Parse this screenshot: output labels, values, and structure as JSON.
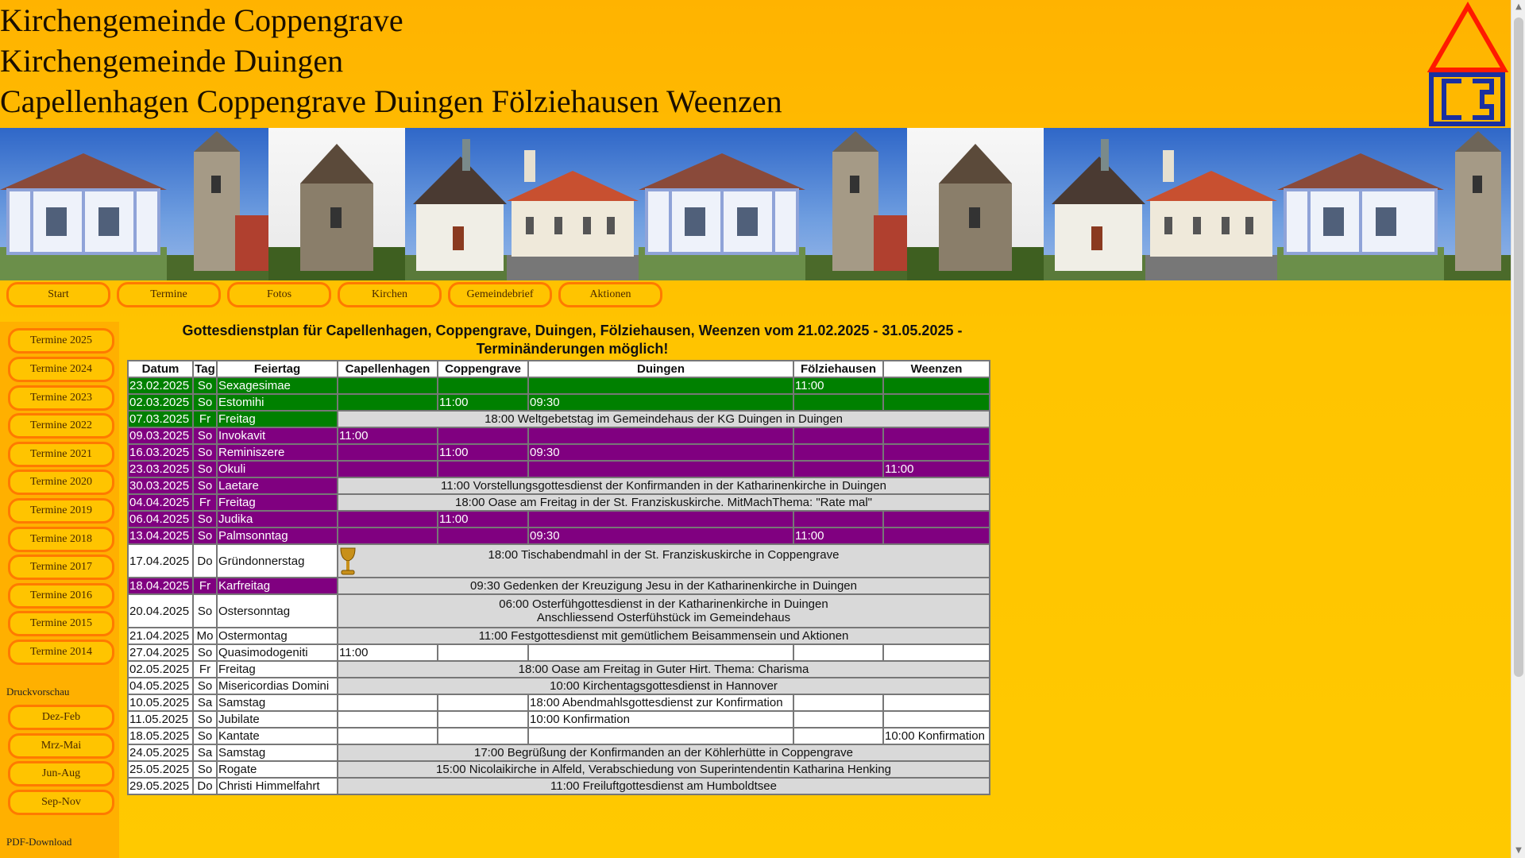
{
  "header": {
    "line1": "Kirchengemeinde Coppengrave",
    "line2": "Kirchengemeinde Duingen",
    "line3": "Capellenhagen Coppengrave Duingen Fölziehausen Weenzen"
  },
  "nav": {
    "start": "Start",
    "termine": "Termine",
    "fotos": "Fotos",
    "kirchen": "Kirchen",
    "gemeindebrief": "Gemeindebrief",
    "aktionen": "Aktionen"
  },
  "sidebar": {
    "years": [
      "Termine 2025",
      "Termine 2024",
      "Termine 2023",
      "Termine 2022",
      "Termine 2021",
      "Termine 2020",
      "Termine 2019",
      "Termine 2018",
      "Termine 2017",
      "Termine 2016",
      "Termine 2015",
      "Termine 2014"
    ],
    "druck_label": "Druckvorschau",
    "druck": [
      "Dez-Feb",
      "Mrz-Mai",
      "Jun-Aug",
      "Sep-Nov"
    ],
    "pdf_label": "PDF-Download"
  },
  "main": {
    "heading": "Gottesdienstplan für Capellenhagen, Coppengrave, Duingen, Fölziehausen, Weenzen vom 21.02.2025 - 31.05.2025 - Terminänderungen möglich!",
    "columns": [
      "Datum",
      "Tag",
      "Feiertag",
      "Capellenhagen",
      "Coppengrave",
      "Duingen",
      "Fölziehausen",
      "Weenzen"
    ],
    "rows": [
      {
        "datum": "23.02.2025",
        "tag": "So",
        "feiertag": "Sexagesimae",
        "color": "g",
        "cells": [
          "",
          "",
          "",
          "11:00",
          ""
        ]
      },
      {
        "datum": "02.03.2025",
        "tag": "So",
        "feiertag": "Estomihi",
        "color": "g",
        "cells": [
          "",
          "11:00",
          "09:30",
          "",
          ""
        ]
      },
      {
        "datum": "07.03.2025",
        "tag": "Fr",
        "feiertag": "Freitag",
        "color": "g",
        "span": "18:00 Weltgebetstag im Gemeindehaus der KG Duingen in Duingen"
      },
      {
        "datum": "09.03.2025",
        "tag": "So",
        "feiertag": "Invokavit",
        "color": "p",
        "cells": [
          "11:00",
          "",
          "",
          "",
          ""
        ]
      },
      {
        "datum": "16.03.2025",
        "tag": "So",
        "feiertag": "Reminiszere",
        "color": "p",
        "cells": [
          "",
          "11:00",
          "09:30",
          "",
          ""
        ]
      },
      {
        "datum": "23.03.2025",
        "tag": "So",
        "feiertag": "Okuli",
        "color": "p",
        "cells": [
          "",
          "",
          "",
          "",
          "11:00"
        ]
      },
      {
        "datum": "30.03.2025",
        "tag": "So",
        "feiertag": "Laetare",
        "color": "p",
        "span": "11:00 Vorstellungsgottesdienst der Konfirmanden in der Katharinenkirche in Duingen"
      },
      {
        "datum": "04.04.2025",
        "tag": "Fr",
        "feiertag": "Freitag",
        "color": "p",
        "span": "18:00 Oase am Freitag in der St. Franziskuskirche. MitMachThema: \"Rate mal\""
      },
      {
        "datum": "06.04.2025",
        "tag": "So",
        "feiertag": "Judika",
        "color": "p",
        "cells": [
          "",
          "11:00",
          "",
          "",
          ""
        ]
      },
      {
        "datum": "13.04.2025",
        "tag": "So",
        "feiertag": "Palmsonntag",
        "color": "p",
        "cells": [
          "",
          "",
          "09:30",
          "11:00",
          ""
        ]
      },
      {
        "datum": "17.04.2025",
        "tag": "Do",
        "feiertag": "Gründonnerstag",
        "color": "w",
        "span": "18:00 Tischabendmahl in der St. Franziskuskirche in Coppengrave",
        "chalice": true,
        "tall": true
      },
      {
        "datum": "18.04.2025",
        "tag": "Fr",
        "feiertag": "Karfreitag",
        "color": "p",
        "span": "09:30 Gedenken der Kreuzigung Jesu in der Katharinenkirche in Duingen"
      },
      {
        "datum": "20.04.2025",
        "tag": "So",
        "feiertag": "Ostersonntag",
        "color": "w",
        "span": "06:00 Osterfühgottesdienst in der Katharinenkirche in Duingen",
        "span2": "Anschliessend Osterfühstück im Gemeindehaus",
        "tall": true
      },
      {
        "datum": "21.04.2025",
        "tag": "Mo",
        "feiertag": "Ostermontag",
        "color": "w",
        "span": "11:00 Festgottesdienst mit gemütlichem Beisammensein und Aktionen"
      },
      {
        "datum": "27.04.2025",
        "tag": "So",
        "feiertag": "Quasimodogeniti",
        "color": "w",
        "cells": [
          "11:00",
          "",
          "",
          "",
          ""
        ]
      },
      {
        "datum": "02.05.2025",
        "tag": "Fr",
        "feiertag": "Freitag",
        "color": "w",
        "span": "18:00 Oase am Freitag in Guter Hirt. Thema: Charisma"
      },
      {
        "datum": "04.05.2025",
        "tag": "So",
        "feiertag": "Misericordias Domini",
        "color": "w",
        "span": "10:00 Kirchentagsgottesdienst in Hannover"
      },
      {
        "datum": "10.05.2025",
        "tag": "Sa",
        "feiertag": "Samstag",
        "color": "w",
        "cells": [
          "",
          "",
          "18:00 Abendmahlsgottesdienst zur Konfirmation",
          "",
          ""
        ]
      },
      {
        "datum": "11.05.2025",
        "tag": "So",
        "feiertag": "Jubilate",
        "color": "w",
        "cells": [
          "",
          "",
          "10:00 Konfirmation",
          "",
          ""
        ]
      },
      {
        "datum": "18.05.2025",
        "tag": "So",
        "feiertag": "Kantate",
        "color": "w",
        "cells": [
          "",
          "",
          "",
          "",
          "10:00 Konfirmation"
        ]
      },
      {
        "datum": "24.05.2025",
        "tag": "Sa",
        "feiertag": "Samstag",
        "color": "w",
        "span": "17:00 Begrüßung der Konfirmanden an der Köhlerhütte in Coppengrave"
      },
      {
        "datum": "25.05.2025",
        "tag": "So",
        "feiertag": "Rogate",
        "color": "w",
        "span": "15:00 Nicolaikirche in Alfeld, Verabschiedung von Superintendentin Katharina Henking"
      },
      {
        "datum": "29.05.2025",
        "tag": "Do",
        "feiertag": "Christi Himmelfahrt",
        "color": "w",
        "span": "11:00 Freiluftgottesdienst am Humboldtsee"
      }
    ]
  },
  "colors": {
    "green": "#008000",
    "purple": "#800080",
    "span_gray": "#d9d9d9",
    "accent": "#ff7a00"
  }
}
